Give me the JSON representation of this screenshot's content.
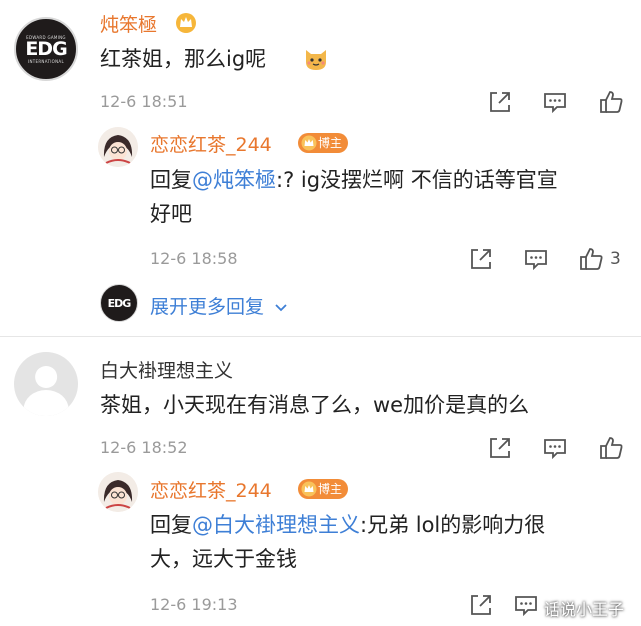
{
  "comments": [
    {
      "author": "炖笨極",
      "text_before_emoji": "红茶姐，那么ig呢",
      "emoji": "cat-emoji",
      "time": "12-6 18:51",
      "reply": {
        "author": "恋恋红茶_244",
        "badge": "博主",
        "prefix": "回复",
        "mention": "@炖笨極",
        "text_line1": ":? ig没摆烂啊 不信的话等官宣",
        "text_line2": "好吧",
        "time": "12-6 18:58",
        "like_count": "3"
      },
      "expand_label": "展开更多回复"
    },
    {
      "author": "白大褂理想主义",
      "text": "茶姐，小天现在有消息了么，we加价是真的么",
      "time": "12-6 18:52",
      "reply": {
        "author": "恋恋红茶_244",
        "badge": "博主",
        "prefix": "回复",
        "mention": "@白大褂理想主义",
        "text_line1": ":兄弟 lol的影响力很",
        "text_line2": "大，远大于金钱",
        "time": "12-6 19:13"
      }
    }
  ],
  "edg_avatar": {
    "top_text": "EDWARD GAMING",
    "logo": "EDG",
    "bottom_text": "INTERNATIONAL"
  },
  "edg_avatar_small": {
    "logo": "EDG"
  },
  "watermark": "话说小王子",
  "colors": {
    "name_orange": "#e8772e",
    "link_blue": "#3e7fd6",
    "time_gray": "#9a9a9a",
    "badge_orange": "#f28c38"
  },
  "icons": [
    "share-icon",
    "comment-icon",
    "like-icon",
    "chevron-down-icon",
    "crown-icon"
  ]
}
